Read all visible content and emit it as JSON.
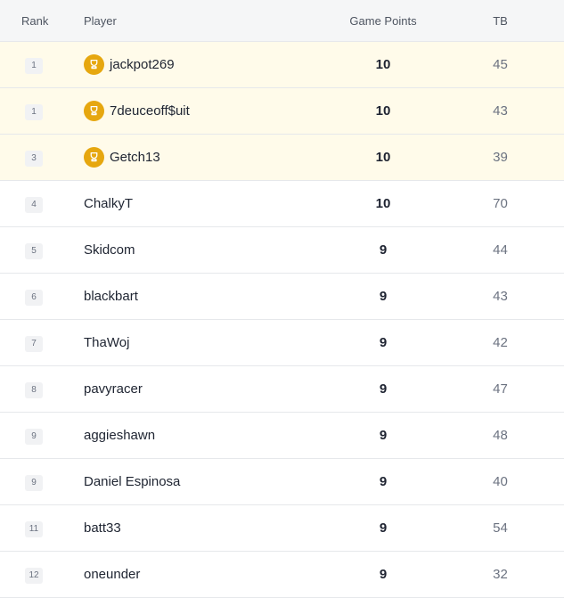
{
  "headers": {
    "rank": "Rank",
    "player": "Player",
    "points": "Game Points",
    "tb": "TB"
  },
  "colors": {
    "top_row_bg": "#fffbea",
    "trophy": "#e6a70f"
  },
  "rows": [
    {
      "rank": "1",
      "player": "jackpot269",
      "points": "10",
      "tb": "45",
      "trophy": true
    },
    {
      "rank": "1",
      "player": "7deuceoff$uit",
      "points": "10",
      "tb": "43",
      "trophy": true
    },
    {
      "rank": "3",
      "player": "Getch13",
      "points": "10",
      "tb": "39",
      "trophy": true
    },
    {
      "rank": "4",
      "player": "ChalkyT",
      "points": "10",
      "tb": "70",
      "trophy": false
    },
    {
      "rank": "5",
      "player": "Skidcom",
      "points": "9",
      "tb": "44",
      "trophy": false
    },
    {
      "rank": "6",
      "player": "blackbart",
      "points": "9",
      "tb": "43",
      "trophy": false
    },
    {
      "rank": "7",
      "player": "ThaWoj",
      "points": "9",
      "tb": "42",
      "trophy": false
    },
    {
      "rank": "8",
      "player": "pavyracer",
      "points": "9",
      "tb": "47",
      "trophy": false
    },
    {
      "rank": "9",
      "player": "aggieshawn",
      "points": "9",
      "tb": "48",
      "trophy": false
    },
    {
      "rank": "9",
      "player": "Daniel Espinosa",
      "points": "9",
      "tb": "40",
      "trophy": false
    },
    {
      "rank": "11",
      "player": "batt33",
      "points": "9",
      "tb": "54",
      "trophy": false
    },
    {
      "rank": "12",
      "player": "oneunder",
      "points": "9",
      "tb": "32",
      "trophy": false
    }
  ]
}
